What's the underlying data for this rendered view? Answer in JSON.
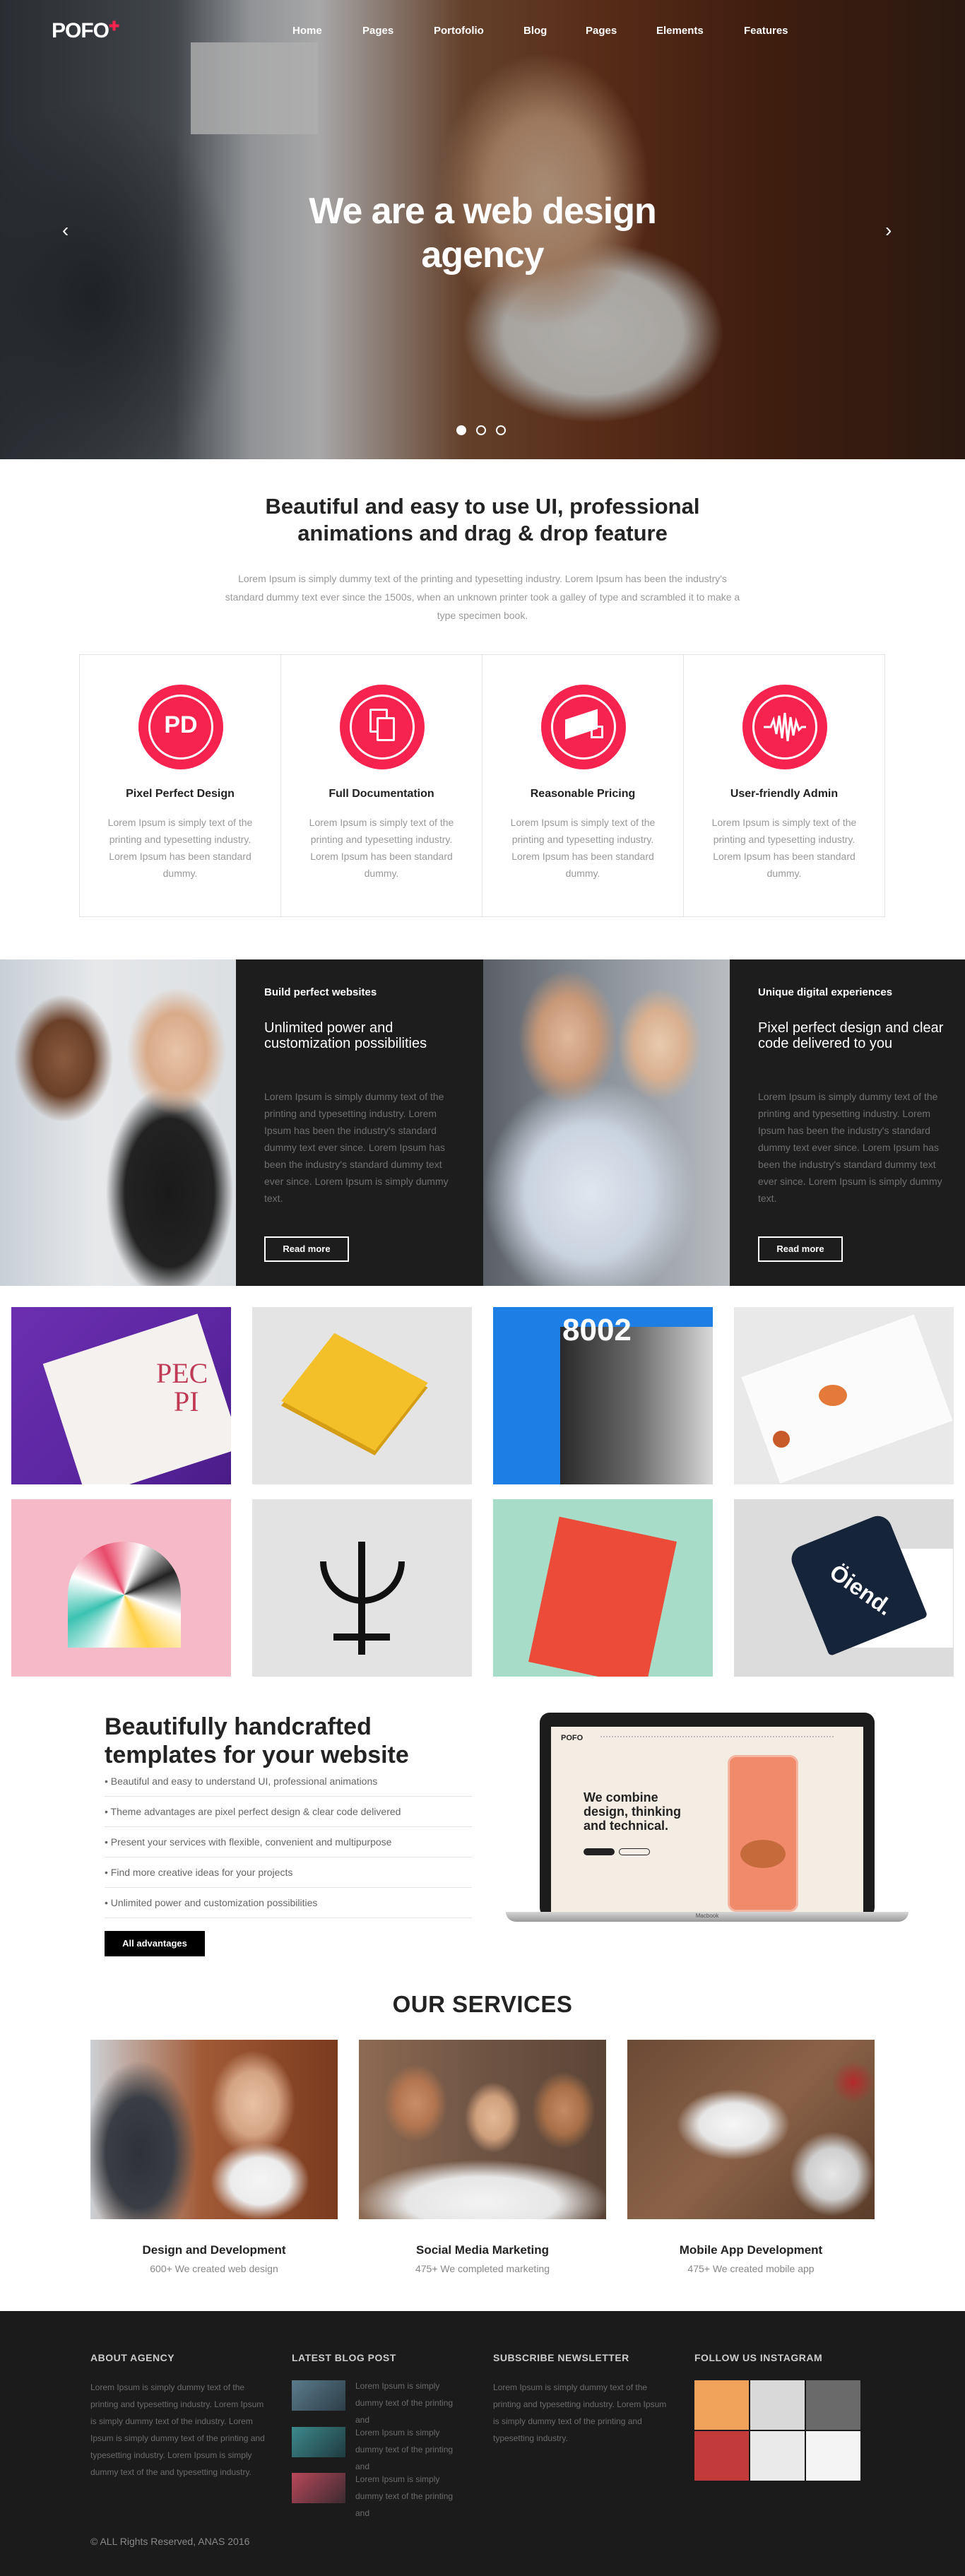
{
  "brand": {
    "logo": "POFO",
    "accent": "#f5234e"
  },
  "nav": {
    "items": [
      "Home",
      "Pages",
      "Portofolio",
      "Blog",
      "Pages",
      "Elements",
      "Features"
    ]
  },
  "hero": {
    "title": "We are a web design agency"
  },
  "intro": {
    "title": "Beautiful and easy to use UI, professional animations and drag & drop feature",
    "text": "Lorem Ipsum is simply dummy text of the printing and typesetting industry. Lorem Ipsum has been the industry's standard dummy text ever since the 1500s, when an unknown printer took a galley of type and scrambled it to make a type specimen book."
  },
  "features": [
    {
      "title": "Pixel Perfect Design",
      "text": "Lorem Ipsum is simply text of the printing and typesetting industry. Lorem Ipsum has been standard dummy.",
      "icon": "pd-icon"
    },
    {
      "title": "Full Documentation",
      "text": "Lorem Ipsum is simply text of the printing and typesetting industry. Lorem Ipsum has been standard dummy.",
      "icon": "documents-icon"
    },
    {
      "title": "Reasonable Pricing",
      "text": "Lorem Ipsum is simply text of the printing and typesetting industry. Lorem Ipsum has been standard dummy.",
      "icon": "price-tag-icon"
    },
    {
      "title": "User-friendly Admin",
      "text": "Lorem Ipsum is simply text of the printing and typesetting industry. Lorem Ipsum has been standard dummy.",
      "icon": "waveform-icon"
    }
  ],
  "strips": [
    {
      "kicker": "Build perfect websites",
      "heading": "Unlimited power and customization possibilities",
      "text": "Lorem Ipsum is simply dummy text of the printing and typesetting industry. Lorem Ipsum has been the industry's standard dummy text ever since. Lorem Ipsum has been the industry's standard dummy text ever since. Lorem Ipsum is simply dummy text.",
      "button": "Read more"
    },
    {
      "kicker": "Unique digital experiences",
      "heading": "Pixel perfect design and clear code delivered to you",
      "text": "Lorem Ipsum is simply dummy text of the printing and typesetting industry. Lorem Ipsum has been the industry's standard dummy text ever since. Lorem Ipsum has been the industry's standard dummy text ever since. Lorem Ipsum is simply dummy text.",
      "button": "Read more"
    }
  ],
  "portfolio": {
    "texts": [
      "PEC",
      "PI",
      "8002",
      "Öiend."
    ]
  },
  "templates": {
    "title": "Beautifully handcrafted templates for your website",
    "items": [
      "Beautiful and easy to understand UI, professional animations",
      "Theme advantages are pixel perfect design & clear code delivered",
      "Present your services with flexible, convenient and multipurpose",
      "Find more creative ideas for your projects",
      "Unlimited power and customization possibilities"
    ],
    "button": "All advantages",
    "laptop": {
      "logo": "POFO",
      "headline": "We combine design, thinking and technical.",
      "brand": "Macbook"
    }
  },
  "services": {
    "heading": "OUR SERVICES",
    "items": [
      {
        "title": "Design and Development",
        "sub": "600+ We created web design"
      },
      {
        "title": "Social Media Marketing",
        "sub": "475+ We completed marketing"
      },
      {
        "title": "Mobile App Development",
        "sub": "475+ We created mobile app"
      }
    ]
  },
  "footer": {
    "about": {
      "heading": "ABOUT AGENCY",
      "text": "Lorem Ipsum is simply dummy text of the printing and typesetting industry. Lorem Ipsum is simply dummy text of the industry. Lorem Ipsum is simply dummy text of the printing and typesetting industry. Lorem Ipsum is simply dummy text of the and typesetting industry."
    },
    "blog": {
      "heading": "LATEST BLOG POST",
      "posts": [
        "Lorem Ipsum is simply dummy text of the printing and",
        "Lorem Ipsum is simply dummy text of the printing and",
        "Lorem Ipsum is simply dummy text of the printing and"
      ]
    },
    "newsletter": {
      "heading": "SUBSCRIBE NEWSLETTER",
      "text": "Lorem Ipsum is simply dummy text of the printing and typesetting industry. Lorem Ipsum is simply dummy text of the printing and typesetting industry."
    },
    "instagram": {
      "heading": "FOLLOW US INSTAGRAM"
    },
    "copyright": "ALL Rights Reserved, ANAS 2016"
  }
}
